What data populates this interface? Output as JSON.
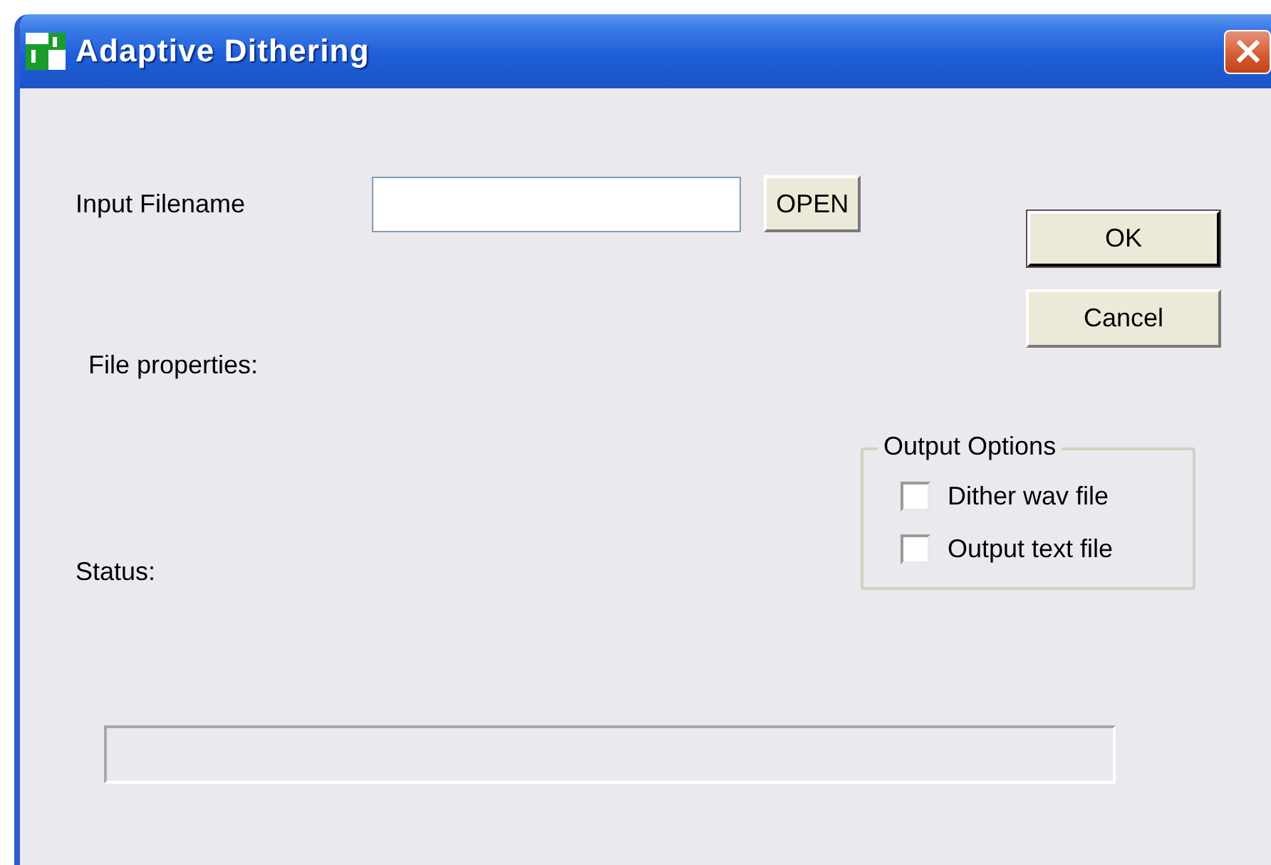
{
  "window": {
    "title": "Adaptive Dithering"
  },
  "input_filename": {
    "label": "Input Filename"
  },
  "open_button": "OPEN",
  "buttons": [
    {
      "label": "OK",
      "default": true
    },
    {
      "label": "Cancel",
      "default": false
    }
  ],
  "file_properties_label": "File properties:",
  "status_label": "Status:",
  "output_options": {
    "title": "Output Options",
    "options": [
      {
        "label": "Dither wav file",
        "checked": false
      },
      {
        "label": "Output text file",
        "checked": false
      }
    ]
  }
}
